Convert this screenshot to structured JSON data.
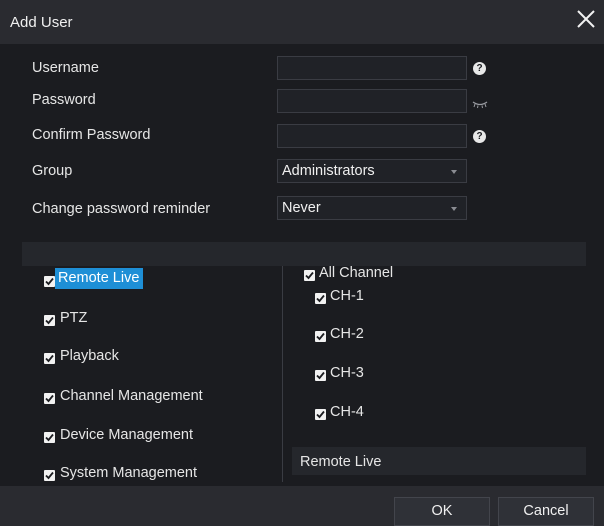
{
  "dialog": {
    "title": "Add User"
  },
  "form": {
    "username_label": "Username",
    "password_label": "Password",
    "confirm_password_label": "Confirm Password",
    "group_label": "Group",
    "group_value": "Administrators",
    "reminder_label": "Change password reminder",
    "reminder_value": "Never",
    "username_value": "",
    "password_value": "",
    "confirm_password_value": "",
    "help_glyph": "?"
  },
  "permissions": [
    {
      "label": "Remote Live",
      "checked": true,
      "selected": true
    },
    {
      "label": "PTZ",
      "checked": true
    },
    {
      "label": "Playback",
      "checked": true
    },
    {
      "label": "Channel Management",
      "checked": true
    },
    {
      "label": "Device Management",
      "checked": true
    },
    {
      "label": "System Management",
      "checked": true
    }
  ],
  "channels": {
    "all_label": "All Channel",
    "items": [
      {
        "label": "CH-1",
        "checked": true
      },
      {
        "label": "CH-2",
        "checked": true
      },
      {
        "label": "CH-3",
        "checked": true
      },
      {
        "label": "CH-4",
        "checked": true
      }
    ]
  },
  "info_text": "Remote Live",
  "buttons": {
    "ok": "OK",
    "cancel": "Cancel"
  },
  "colors": {
    "background": "#1b1c20",
    "accent": "#1e8fd6"
  },
  "icons": [
    "close-icon",
    "help-icon",
    "eye-icon",
    "chevron-down-icon",
    "checkbox-icon"
  ]
}
